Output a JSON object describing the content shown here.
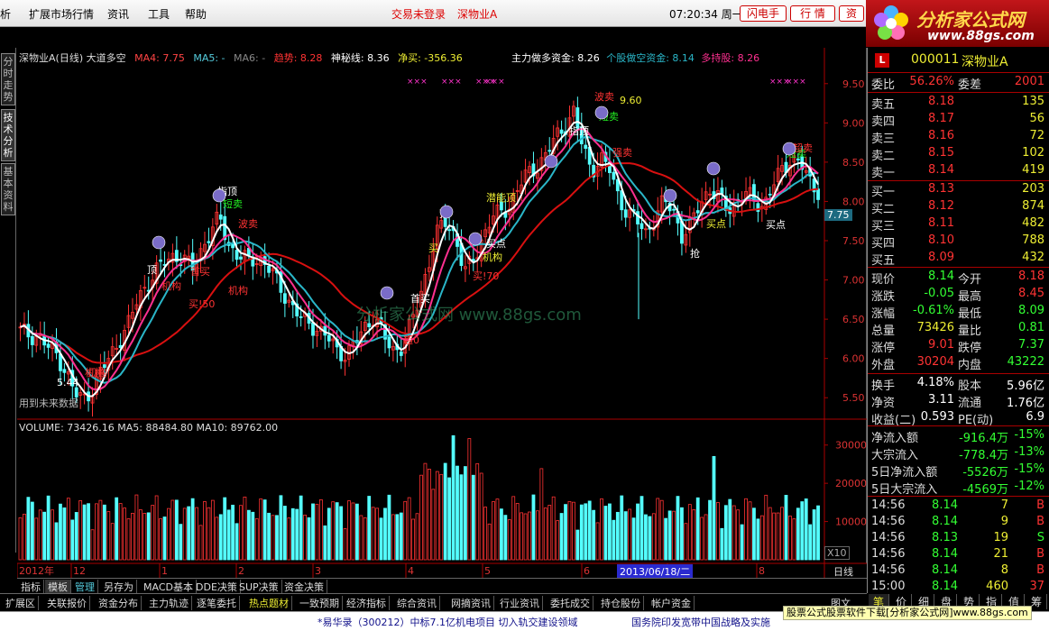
{
  "menu": {
    "items": [
      "析",
      "扩展市场行情",
      "资讯",
      "工具",
      "帮助"
    ],
    "status": [
      "交易未登录",
      "深物业A"
    ],
    "clock": "07:20:34 周一",
    "buttons": [
      "闪电手",
      "行 情",
      "资"
    ]
  },
  "logo": {
    "title": "分析家公式网",
    "url": "www.88gs.com"
  },
  "left_tabs": [
    "分时走势",
    "技术分析",
    "基本资料"
  ],
  "chart": {
    "header": {
      "name": "深物业A(日线) 大道多空",
      "ma4": "MA4: 7.75",
      "ma5": "MA5: -",
      "ma6": "MA6: -",
      "trend": "趋势: 8.28",
      "shenmi": "神秘线: 8.36",
      "jingmai": "净买: -356.36",
      "zhuli": "主力做多资金: 8.26",
      "gegu": "个股做空资金: 8.14",
      "duochi": "多持股: 8.26"
    },
    "watermark": "分析家公式网 www.88gs.com",
    "future_note": "用到未来数据",
    "annotations": [
      {
        "text": "波卖"
      },
      {
        "text": "9.60"
      },
      {
        "text": "短卖"
      },
      {
        "text": "指顶"
      },
      {
        "text": "指顶"
      },
      {
        "text": "短卖"
      },
      {
        "text": "波卖"
      },
      {
        "text": "顶"
      },
      {
        "text": "机构"
      },
      {
        "text": "买!50"
      },
      {
        "text": "首买"
      },
      {
        "text": "机构"
      },
      {
        "text": "机构"
      },
      {
        "text": "5.44"
      },
      {
        "text": "顶"
      },
      {
        "text": "买"
      },
      {
        "text": "买点"
      },
      {
        "text": "机构"
      },
      {
        "text": "首买"
      },
      {
        "text": "买!70"
      },
      {
        "text": "潜能顶"
      },
      {
        "text": "强卖"
      },
      {
        "text": "短卖"
      },
      {
        "text": "机构"
      },
      {
        "text": "抢"
      },
      {
        "text": "买点"
      },
      {
        "text": "买点"
      },
      {
        "text": "超卖"
      },
      {
        "text": "超0"
      }
    ],
    "volume_header": "VOLUME: 73426.16  MA5: 88484.80  MA10: 89762.00",
    "x_labels": [
      "2012年",
      "12",
      "1",
      "2",
      "3",
      "4",
      "5",
      "6",
      "7",
      "8"
    ],
    "cursor_date": "2013/06/18/二",
    "period": "日线",
    "x10": "X10",
    "current_price_tag": "7.75"
  },
  "chart_data": {
    "type": "candlestick",
    "title": "深物业A(日线) 大道多空",
    "ylim": [
      5.25,
      9.75
    ],
    "y_ticks": [
      "9.50",
      "9.00",
      "8.50",
      "8.00",
      "7.50",
      "7.00",
      "6.50",
      "6.00",
      "5.50"
    ],
    "volume_ticks": [
      "30000",
      "20000",
      "10000"
    ],
    "volume_ylim": [
      0,
      33000
    ],
    "close_path": [
      6.35,
      6.3,
      6.28,
      6.15,
      6.05,
      5.85,
      5.55,
      5.48,
      5.62,
      5.85,
      6.05,
      6.25,
      6.45,
      6.78,
      6.95,
      7.1,
      7.25,
      7.32,
      7.25,
      7.15,
      7.4,
      7.6,
      7.8,
      7.45,
      7.3,
      7.25,
      7.28,
      7.2,
      7.05,
      6.85,
      6.65,
      6.5,
      6.45,
      6.35,
      6.25,
      6.1,
      6.05,
      6.2,
      6.4,
      6.55,
      6.3,
      6.1,
      6.15,
      6.4,
      6.75,
      7.2,
      7.6,
      7.75,
      7.55,
      7.1,
      7.25,
      7.55,
      7.8,
      7.85,
      7.95,
      8.2,
      8.35,
      8.45,
      8.6,
      8.8,
      8.95,
      9.15,
      8.7,
      8.4,
      8.55,
      8.4,
      8.05,
      7.85,
      7.75,
      7.6,
      7.8,
      8.0,
      7.9,
      7.55,
      7.7,
      8.0,
      8.15,
      8.05,
      7.9,
      8.0,
      8.1,
      8.0,
      7.95,
      8.2,
      8.4,
      8.55,
      8.5,
      8.25,
      8.14
    ]
  },
  "right_panel": {
    "code": "000011",
    "name": "深物业A",
    "wei_bi_label": "委比",
    "wei_bi": "56.26%",
    "wei_cha_label": "委差",
    "wei_cha": "2001",
    "sell": [
      {
        "label": "卖五",
        "price": "8.18",
        "vol": "135"
      },
      {
        "label": "卖四",
        "price": "8.17",
        "vol": "56"
      },
      {
        "label": "卖三",
        "price": "8.16",
        "vol": "72"
      },
      {
        "label": "卖二",
        "price": "8.15",
        "vol": "102"
      },
      {
        "label": "卖一",
        "price": "8.14",
        "vol": "419"
      }
    ],
    "buy": [
      {
        "label": "买一",
        "price": "8.13",
        "vol": "203"
      },
      {
        "label": "买二",
        "price": "8.12",
        "vol": "874"
      },
      {
        "label": "买三",
        "price": "8.11",
        "vol": "482"
      },
      {
        "label": "买四",
        "price": "8.10",
        "vol": "788"
      },
      {
        "label": "买五",
        "price": "8.09",
        "vol": "432"
      }
    ],
    "stats": [
      {
        "l1": "现价",
        "v1": "8.14",
        "l2": "今开",
        "v2": "8.18",
        "c1": "#3f3",
        "c2": "#f33"
      },
      {
        "l1": "涨跌",
        "v1": "-0.05",
        "l2": "最高",
        "v2": "8.45",
        "c1": "#3f3",
        "c2": "#f33"
      },
      {
        "l1": "涨幅",
        "v1": "-0.61%",
        "l2": "最低",
        "v2": "8.09",
        "c1": "#3f3",
        "c2": "#3f3"
      },
      {
        "l1": "总量",
        "v1": "73426",
        "l2": "量比",
        "v2": "0.81",
        "c1": "#ee3",
        "c2": "#3f3"
      },
      {
        "l1": "涨停",
        "v1": "9.01",
        "l2": "跌停",
        "v2": "7.37",
        "c1": "#f33",
        "c2": "#3f3"
      },
      {
        "l1": "外盘",
        "v1": "30204",
        "l2": "内盘",
        "v2": "43222",
        "c1": "#f33",
        "c2": "#3f3"
      }
    ],
    "fund": [
      {
        "l1": "换手",
        "v1": "4.18%",
        "l2": "股本",
        "v2": "5.96亿"
      },
      {
        "l1": "净资",
        "v1": "3.11",
        "l2": "流通",
        "v2": "1.76亿"
      },
      {
        "l1": "收益(二)",
        "v1": "0.593",
        "l2": "PE(动)",
        "v2": "6.9"
      }
    ],
    "flows": [
      {
        "label": "净流入额",
        "val": "-916.4万",
        "pct": "-15%"
      },
      {
        "label": "大宗流入",
        "val": "-778.4万",
        "pct": "-13%"
      },
      {
        "label": "5日净流入额",
        "val": "-5526万",
        "pct": "-15%"
      },
      {
        "label": "5日大宗流入",
        "val": "-4569万",
        "pct": "-12%"
      }
    ],
    "ticks": [
      {
        "time": "14:56",
        "price": "8.14",
        "vol": "7",
        "bs": "B"
      },
      {
        "time": "14:56",
        "price": "8.14",
        "vol": "9",
        "bs": "B"
      },
      {
        "time": "14:56",
        "price": "8.13",
        "vol": "19",
        "bs": "S"
      },
      {
        "time": "14:56",
        "price": "8.14",
        "vol": "21",
        "bs": "B"
      },
      {
        "time": "14:56",
        "price": "8.14",
        "vol": "8",
        "bs": "B"
      },
      {
        "time": "15:00",
        "price": "8.14",
        "vol": "460",
        "bs": "37"
      }
    ],
    "tabs": [
      "笔",
      "价",
      "细",
      "盘",
      "势",
      "指",
      "值",
      "筹"
    ]
  },
  "bottom_tabs": [
    "指标",
    "模板",
    "管理",
    "另存为",
    "MACD基本",
    "DDE决策",
    "SUP决策",
    "资金决策"
  ],
  "ext_tabs": [
    "扩展区",
    "关联报价",
    "资金分布",
    "主力轨迹",
    "逐笔委托",
    "热点题材",
    "一致预期",
    "经济指标",
    "综合资讯",
    "网摘资讯",
    "行业资讯",
    "委托成交",
    "持仓股份",
    "帐户资金"
  ],
  "ext_right": "图文F10",
  "ticker": {
    "left": "*易华录（300212）中标7.1亿机电项目 切入轨交建设领域",
    "right": "国务院印发宽带中国战略及实施"
  },
  "download_banner": "股票公式股票软件下载[分析家公式网]www.88gs.com",
  "colors": {
    "up": "#ff3333",
    "down": "#54ffff",
    "bg": "#000000",
    "ma_white": "#ffffff",
    "ma_cyan": "#2ab6c8",
    "ma_red": "#d81010",
    "ma_pink": "#ff3090"
  }
}
